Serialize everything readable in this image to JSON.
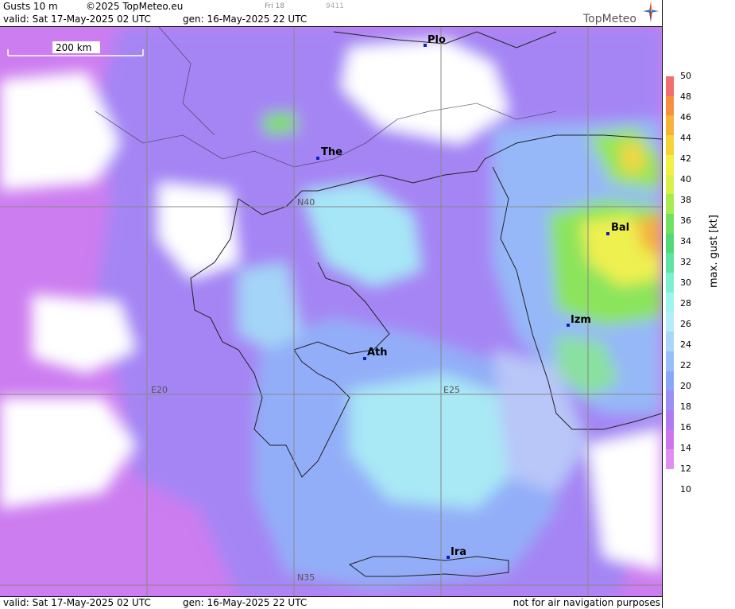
{
  "header": {
    "product": "Gusts 10 m",
    "copyright": "©2025 TopMeteo.eu",
    "valid": "valid:  Sat  17-May-2025  02 UTC",
    "generated": "gen: 16-May-2025 22 UTC",
    "day_tag": "Fri 18",
    "run_code": "9411",
    "brand": "TopMeteo"
  },
  "scale_bar": {
    "label": "200 km"
  },
  "cities": [
    {
      "name": "Plo"
    },
    {
      "name": "The"
    },
    {
      "name": "Bal"
    },
    {
      "name": "Izm"
    },
    {
      "name": "Ath"
    },
    {
      "name": "Ira"
    }
  ],
  "grid_labels": {
    "n40": "N40",
    "n35": "N35",
    "e20": "E20",
    "e25": "E25"
  },
  "legend": {
    "title": "max. gust [kt]",
    "ticks": [
      "50",
      "48",
      "46",
      "44",
      "42",
      "40",
      "38",
      "36",
      "34",
      "32",
      "30",
      "28",
      "26",
      "24",
      "22",
      "20",
      "18",
      "16",
      "14",
      "12",
      "10"
    ],
    "colors": [
      "#f26d6d",
      "#f5903f",
      "#f7b23a",
      "#f5d43a",
      "#f2ef45",
      "#d9f04a",
      "#a8ec52",
      "#72e060",
      "#55d877",
      "#63e3a3",
      "#7ef0d0",
      "#9ff4ee",
      "#b4ecf7",
      "#a9d6f9",
      "#98bff8",
      "#8aa7f7",
      "#9a8ff5",
      "#b07bf1",
      "#cf76ee",
      "#e08ef2"
    ]
  },
  "footer": {
    "valid": "valid:  Sat  17-May-2025  02 UTC",
    "generated": "gen: 16-May-2025 22 UTC",
    "disclaimer": "not for air navigation purposes"
  }
}
